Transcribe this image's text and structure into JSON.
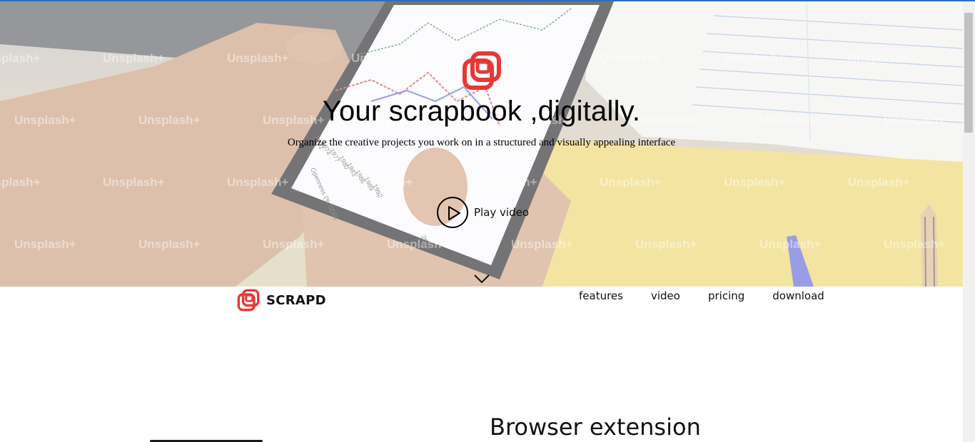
{
  "hero": {
    "title": "Your scrapbook ,digitally.",
    "subtitle": "Organize the creative projects you work on in a structured and visually appealing interface",
    "play_label": "Play video",
    "watermark": "Unsplash+",
    "phone_table_labels": [
      "1972",
      "1974",
      "1977",
      "1980",
      "1983",
      "1986",
      "1989",
      "1992",
      "Openness (% GDP)",
      "2013"
    ]
  },
  "brand": {
    "name": "SCRAPD",
    "accent": "#e53935"
  },
  "nav": {
    "items": [
      {
        "label": "features"
      },
      {
        "label": "video"
      },
      {
        "label": "pricing"
      },
      {
        "label": "download"
      }
    ]
  },
  "section": {
    "title": "Browser extension"
  },
  "icons": {
    "logo": "scrapd-logo-icon",
    "play": "play-icon",
    "scroll_down": "chevron-down-icon"
  }
}
